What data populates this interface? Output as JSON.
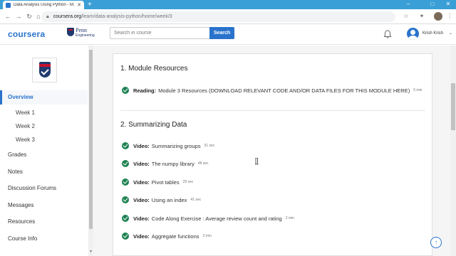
{
  "browser": {
    "tab_title": "Data Analysis Using Python - M...",
    "url_host": "coursera.org",
    "url_path": "/learn/data-analysis-python/home/week/3"
  },
  "header": {
    "logo": "coursera",
    "partner_name": "Penn",
    "partner_sub": "Engineering",
    "search_placeholder": "Search in course",
    "search_button": "Search",
    "user_name": "Krish Krish"
  },
  "sidebar": {
    "active": "Overview",
    "weeks": [
      "Week 1",
      "Week 2",
      "Week 3"
    ],
    "items": [
      "Grades",
      "Notes",
      "Discussion Forums",
      "Messages",
      "Resources",
      "Course Info"
    ]
  },
  "sections": [
    {
      "title": "1. Module Resources",
      "items": [
        {
          "type": "Reading:",
          "title": "Module 3 Resources (DOWNLOAD RELEVANT CODE AND/OR DATA FILES FOR THIS MODULE HERE)",
          "duration": "5 min"
        }
      ]
    },
    {
      "title": "2. Summarizing Data",
      "items": [
        {
          "type": "Video:",
          "title": "Summarizing groups",
          "duration": "51 sec"
        },
        {
          "type": "Video:",
          "title": "The numpy library",
          "duration": "48 sec"
        },
        {
          "type": "Video:",
          "title": "Pivot tables",
          "duration": "29 sec"
        },
        {
          "type": "Video:",
          "title": "Using an index",
          "duration": "41 sec"
        },
        {
          "type": "Video:",
          "title": "Code Along Exercise : Average review count and rating",
          "duration": "2 min"
        },
        {
          "type": "Video:",
          "title": "Aggregate functions",
          "duration": "2 min"
        }
      ]
    }
  ]
}
